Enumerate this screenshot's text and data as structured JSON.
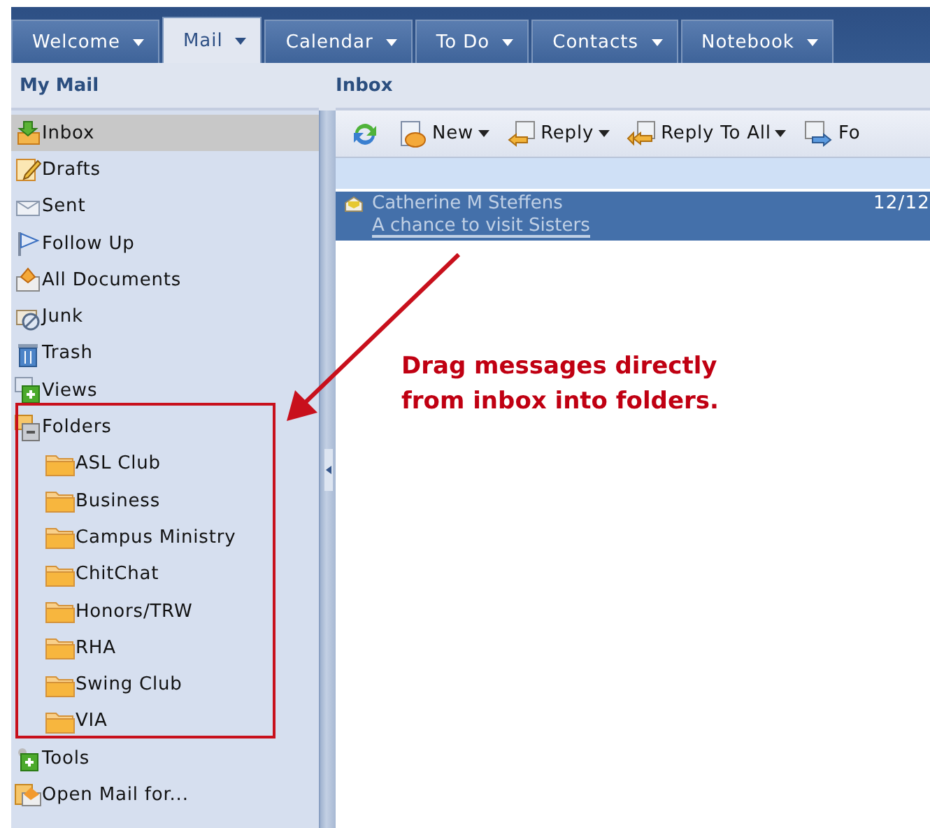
{
  "tabs": [
    {
      "label": "Welcome",
      "selected": false
    },
    {
      "label": "Mail",
      "selected": true
    },
    {
      "label": "Calendar",
      "selected": false
    },
    {
      "label": "To Do",
      "selected": false
    },
    {
      "label": "Contacts",
      "selected": false
    },
    {
      "label": "Notebook",
      "selected": false
    }
  ],
  "sidebar": {
    "title": "My Mail",
    "items": [
      {
        "label": "Inbox",
        "selected": true
      },
      {
        "label": "Drafts",
        "selected": false
      },
      {
        "label": "Sent",
        "selected": false
      },
      {
        "label": "Follow Up",
        "selected": false
      },
      {
        "label": "All Documents",
        "selected": false
      },
      {
        "label": "Junk",
        "selected": false
      },
      {
        "label": "Trash",
        "selected": false
      },
      {
        "label": "Views",
        "selected": false,
        "expanded": false
      },
      {
        "label": "Folders",
        "selected": false,
        "expanded": true,
        "children": [
          {
            "label": "ASL Club",
            "selected": false
          },
          {
            "label": "Business",
            "selected": false
          },
          {
            "label": "Campus Ministry",
            "selected": false
          },
          {
            "label": "ChitChat",
            "selected": false
          },
          {
            "label": "Honors/TRW",
            "selected": false
          },
          {
            "label": "RHA",
            "selected": false
          },
          {
            "label": "Swing Club",
            "selected": false
          },
          {
            "label": "VIA",
            "selected": false
          }
        ]
      },
      {
        "label": "Tools",
        "selected": false,
        "expanded": false
      },
      {
        "label": "Open Mail for...",
        "selected": false
      }
    ]
  },
  "mail": {
    "title": "Inbox",
    "toolbar": [
      {
        "kind": "refresh"
      },
      {
        "label": "New",
        "kind": "menu"
      },
      {
        "label": "Reply",
        "kind": "menu"
      },
      {
        "label": "Reply To All",
        "kind": "menu"
      },
      {
        "label": "Fo",
        "kind": "button"
      }
    ],
    "messages": [
      {
        "sender": "Catherine M Steffens",
        "subject": "A chance to visit Sisters",
        "date": "12/12",
        "selected": true
      }
    ]
  },
  "note": {
    "text": "Drag messages directly from inbox into folders."
  }
}
